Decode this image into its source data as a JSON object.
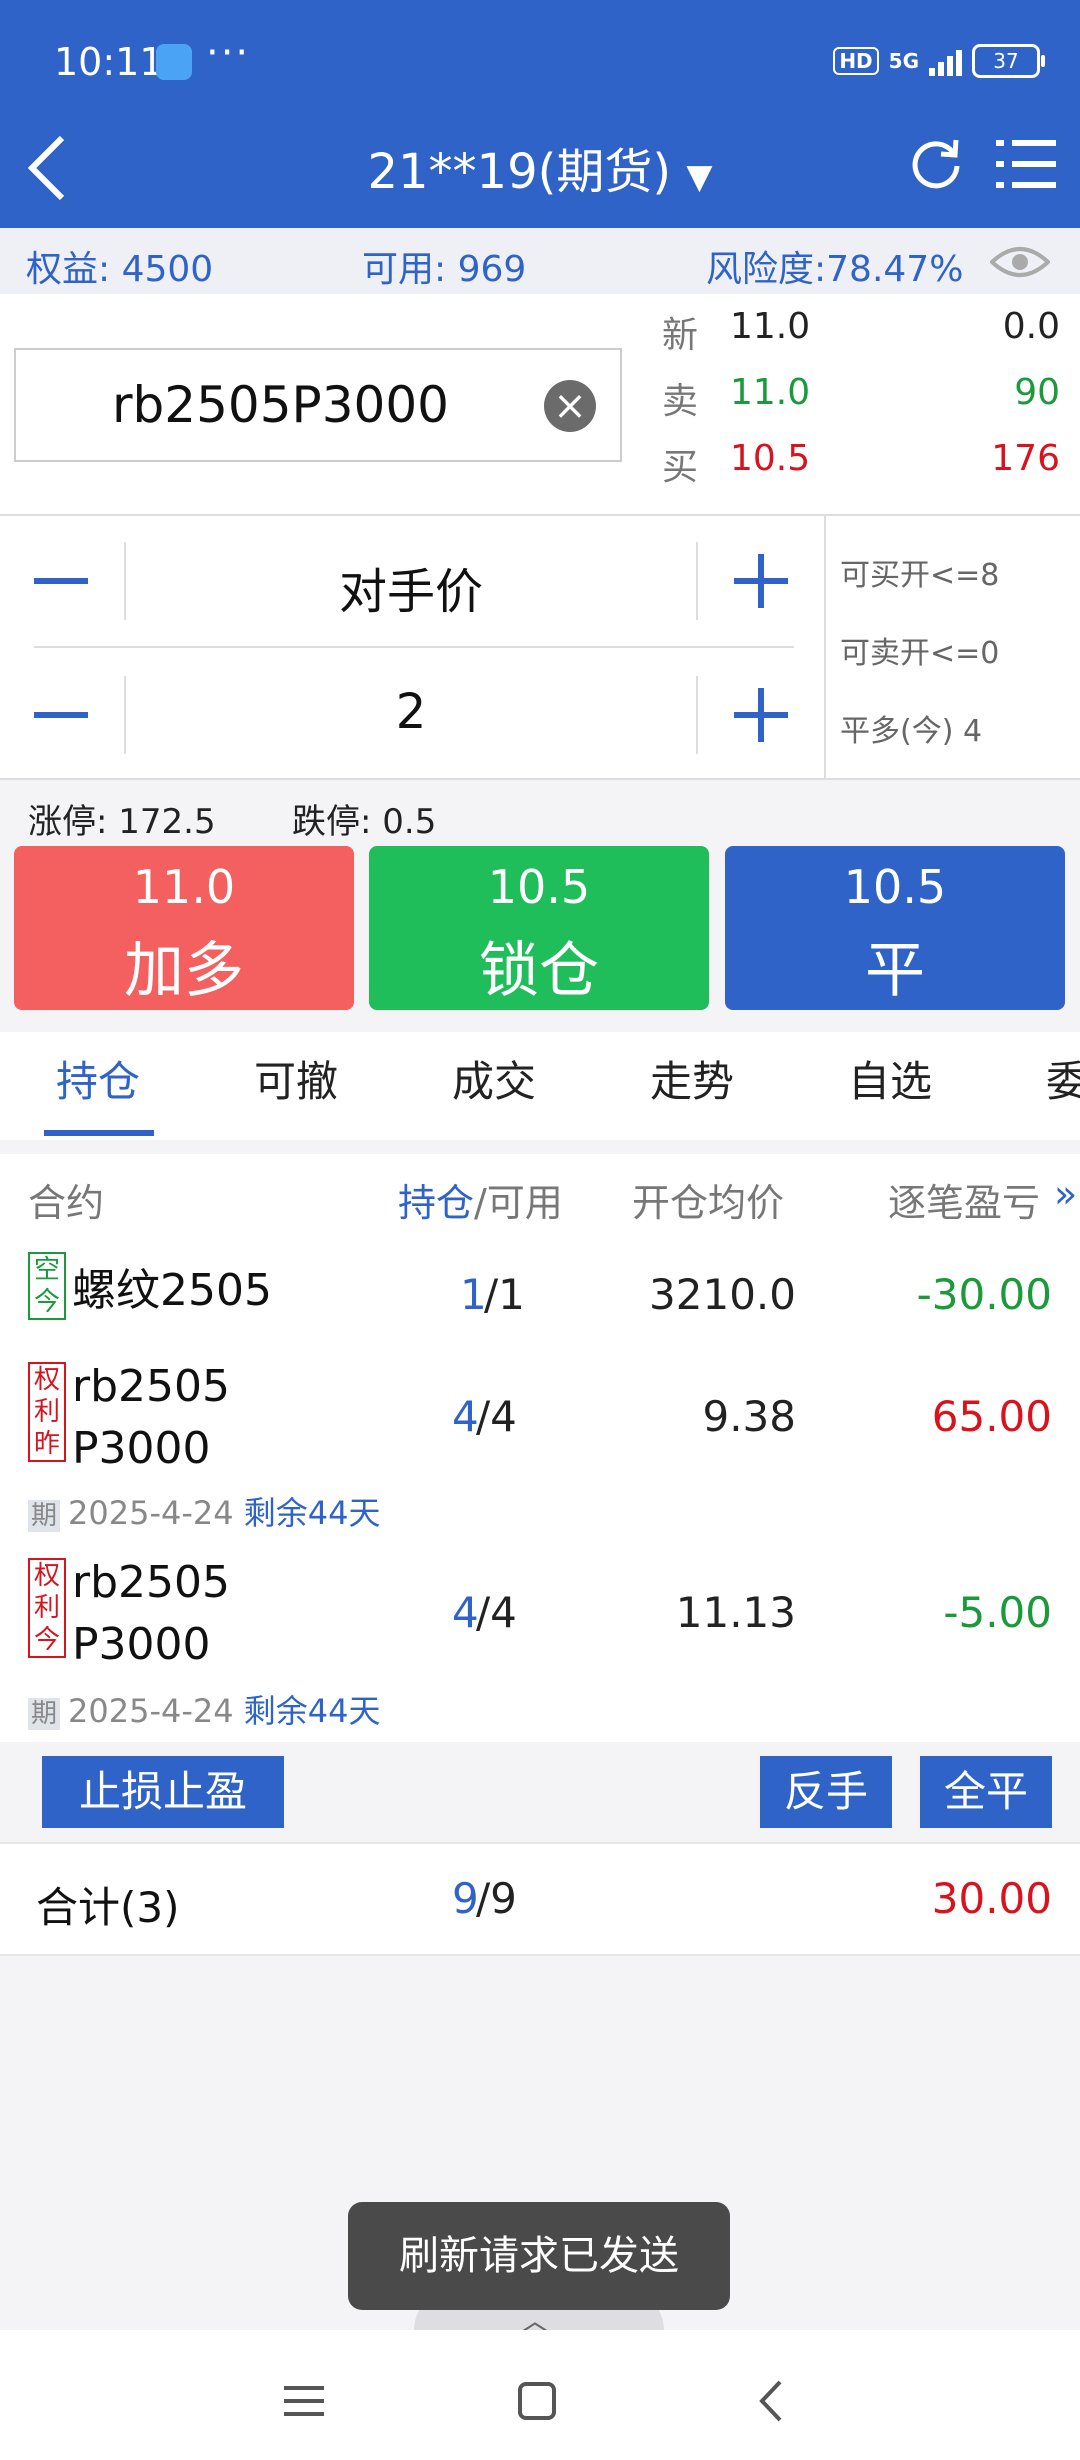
{
  "status": {
    "time": "10:11",
    "dots": "···",
    "hd": "HD",
    "network": "5G",
    "battery": "37"
  },
  "header": {
    "title": "21**19(期货)",
    "dropdown": "▼"
  },
  "account": {
    "equity": "权益: 4500",
    "available": "可用: 969",
    "risk": "风险度:78.47%"
  },
  "quote": {
    "code": "rb2505P3000",
    "rows": [
      {
        "label": "新",
        "price": "11.0",
        "vol": "0.0"
      },
      {
        "label": "卖",
        "price": "11.0",
        "vol": "90"
      },
      {
        "label": "买",
        "price": "10.5",
        "vol": "176"
      }
    ]
  },
  "order": {
    "price_mode": "对手价",
    "qty": "2",
    "can_buy_open": "可买开<=8",
    "can_sell_open": "可卖开<=0",
    "close_long": "平多(今) 4"
  },
  "limits": {
    "up": "涨停: 172.5",
    "down": "跌停: 0.5"
  },
  "buttons": [
    {
      "price": "11.0",
      "label": "加多",
      "color": "#f45f5f"
    },
    {
      "price": "10.5",
      "label": "锁仓",
      "color": "#1fbe5a"
    },
    {
      "price": "10.5",
      "label": "平",
      "color": "#2f63c8"
    }
  ],
  "tabs": [
    "持仓",
    "可撤",
    "成交",
    "走势",
    "自选",
    "委"
  ],
  "table": {
    "headers": {
      "contract": "合约",
      "pos": "持仓",
      "avail": "/可用",
      "avg": "开仓均价",
      "pnl": "逐笔盈亏",
      "more": "»"
    },
    "rows": [
      {
        "tags": [
          "空",
          "今"
        ],
        "name1": "螺纹2505",
        "name2": "",
        "pos": "1",
        "avail": "/1",
        "avg": "3210.0",
        "pnl": "-30.00",
        "pnl_color": "green",
        "expiry_tag": "",
        "expiry": "",
        "remain": ""
      },
      {
        "tags": [
          "权",
          "利",
          "昨"
        ],
        "name1": "rb2505",
        "name2": "P3000",
        "pos": "4",
        "avail": "/4",
        "avg": "9.38",
        "pnl": "65.00",
        "pnl_color": "red",
        "expiry_tag": "期",
        "expiry": "2025-4-24",
        "remain": "剩余44天"
      },
      {
        "tags": [
          "权",
          "利",
          "今"
        ],
        "name1": "rb2505",
        "name2": "P3000",
        "pos": "4",
        "avail": "/4",
        "avg": "11.13",
        "pnl": "-5.00",
        "pnl_color": "green",
        "expiry_tag": "期",
        "expiry": "2025-4-24",
        "remain": "剩余44天"
      }
    ]
  },
  "actions": {
    "stop": "止损止盈",
    "reverse": "反手",
    "close_all": "全平"
  },
  "total": {
    "label": "合计(3)",
    "pos": "9",
    "avail": "/9",
    "pnl": "30.00"
  },
  "toast": "刷新请求已发送"
}
